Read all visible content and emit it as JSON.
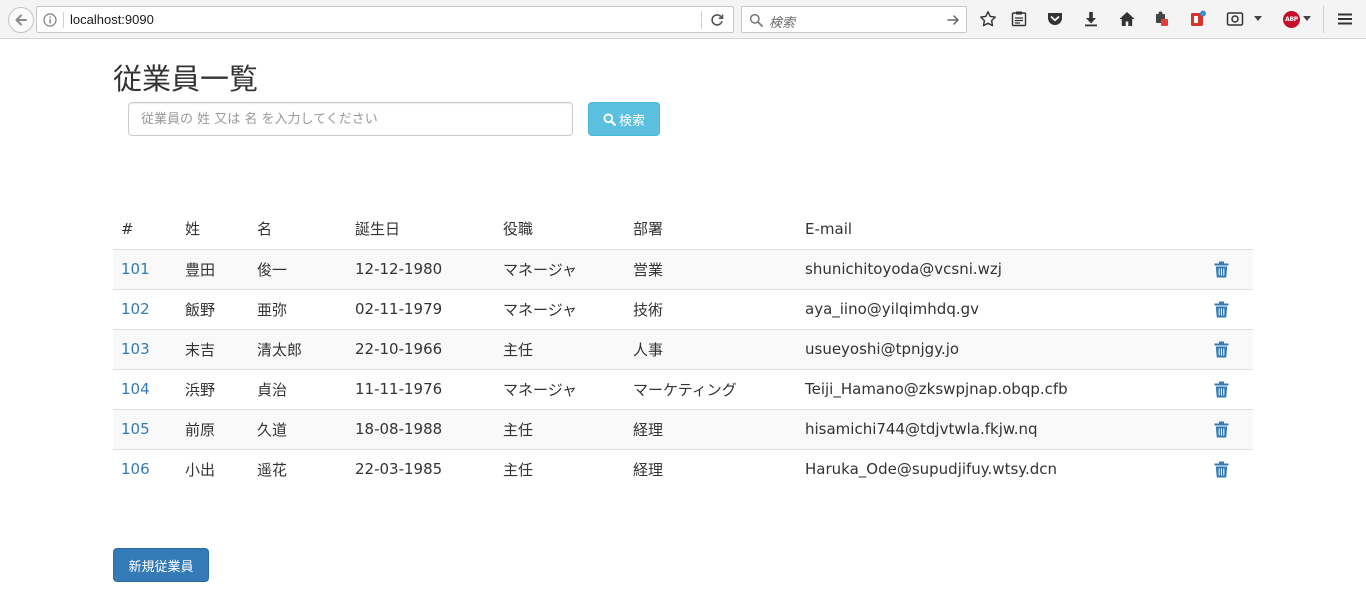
{
  "browser": {
    "url": "localhost:9090",
    "search_placeholder": "検索"
  },
  "page": {
    "title": "従業員一覧",
    "search_placeholder": "従業員の 姓 又は 名 を入力してください",
    "search_button_label": "検索",
    "new_button_label": "新規従業員"
  },
  "table": {
    "headers": [
      "#",
      "姓",
      "名",
      "誕生日",
      "役職",
      "部署",
      "E-mail"
    ],
    "rows": [
      {
        "id": "101",
        "last": "豊田",
        "first": "俊一",
        "birthday": "12-12-1980",
        "title": "マネージャ",
        "dept": "営業",
        "email": "shunichitoyoda@vcsni.wzj"
      },
      {
        "id": "102",
        "last": "飯野",
        "first": "亜弥",
        "birthday": "02-11-1979",
        "title": "マネージャ",
        "dept": "技術",
        "email": "aya_iino@yilqimhdq.gv"
      },
      {
        "id": "103",
        "last": "末吉",
        "first": "清太郎",
        "birthday": "22-10-1966",
        "title": "主任",
        "dept": "人事",
        "email": "usueyoshi@tpnjgy.jo"
      },
      {
        "id": "104",
        "last": "浜野",
        "first": "貞治",
        "birthday": "11-11-1976",
        "title": "マネージャ",
        "dept": "マーケティング",
        "email": "Teiji_Hamano@zkswpjnap.obqp.cfb"
      },
      {
        "id": "105",
        "last": "前原",
        "first": "久道",
        "birthday": "18-08-1988",
        "title": "主任",
        "dept": "経理",
        "email": "hisamichi744@tdjvtwla.fkjw.nq"
      },
      {
        "id": "106",
        "last": "小出",
        "first": "遥花",
        "birthday": "22-03-1985",
        "title": "主任",
        "dept": "経理",
        "email": "Haruka_Ode@supudjifuy.wtsy.dcn"
      }
    ]
  },
  "colors": {
    "link": "#337ab7",
    "info_button": "#5bc0de",
    "primary_button": "#337ab7"
  },
  "icons": {
    "row_delete": "trash-icon",
    "search_button": "search-icon"
  }
}
